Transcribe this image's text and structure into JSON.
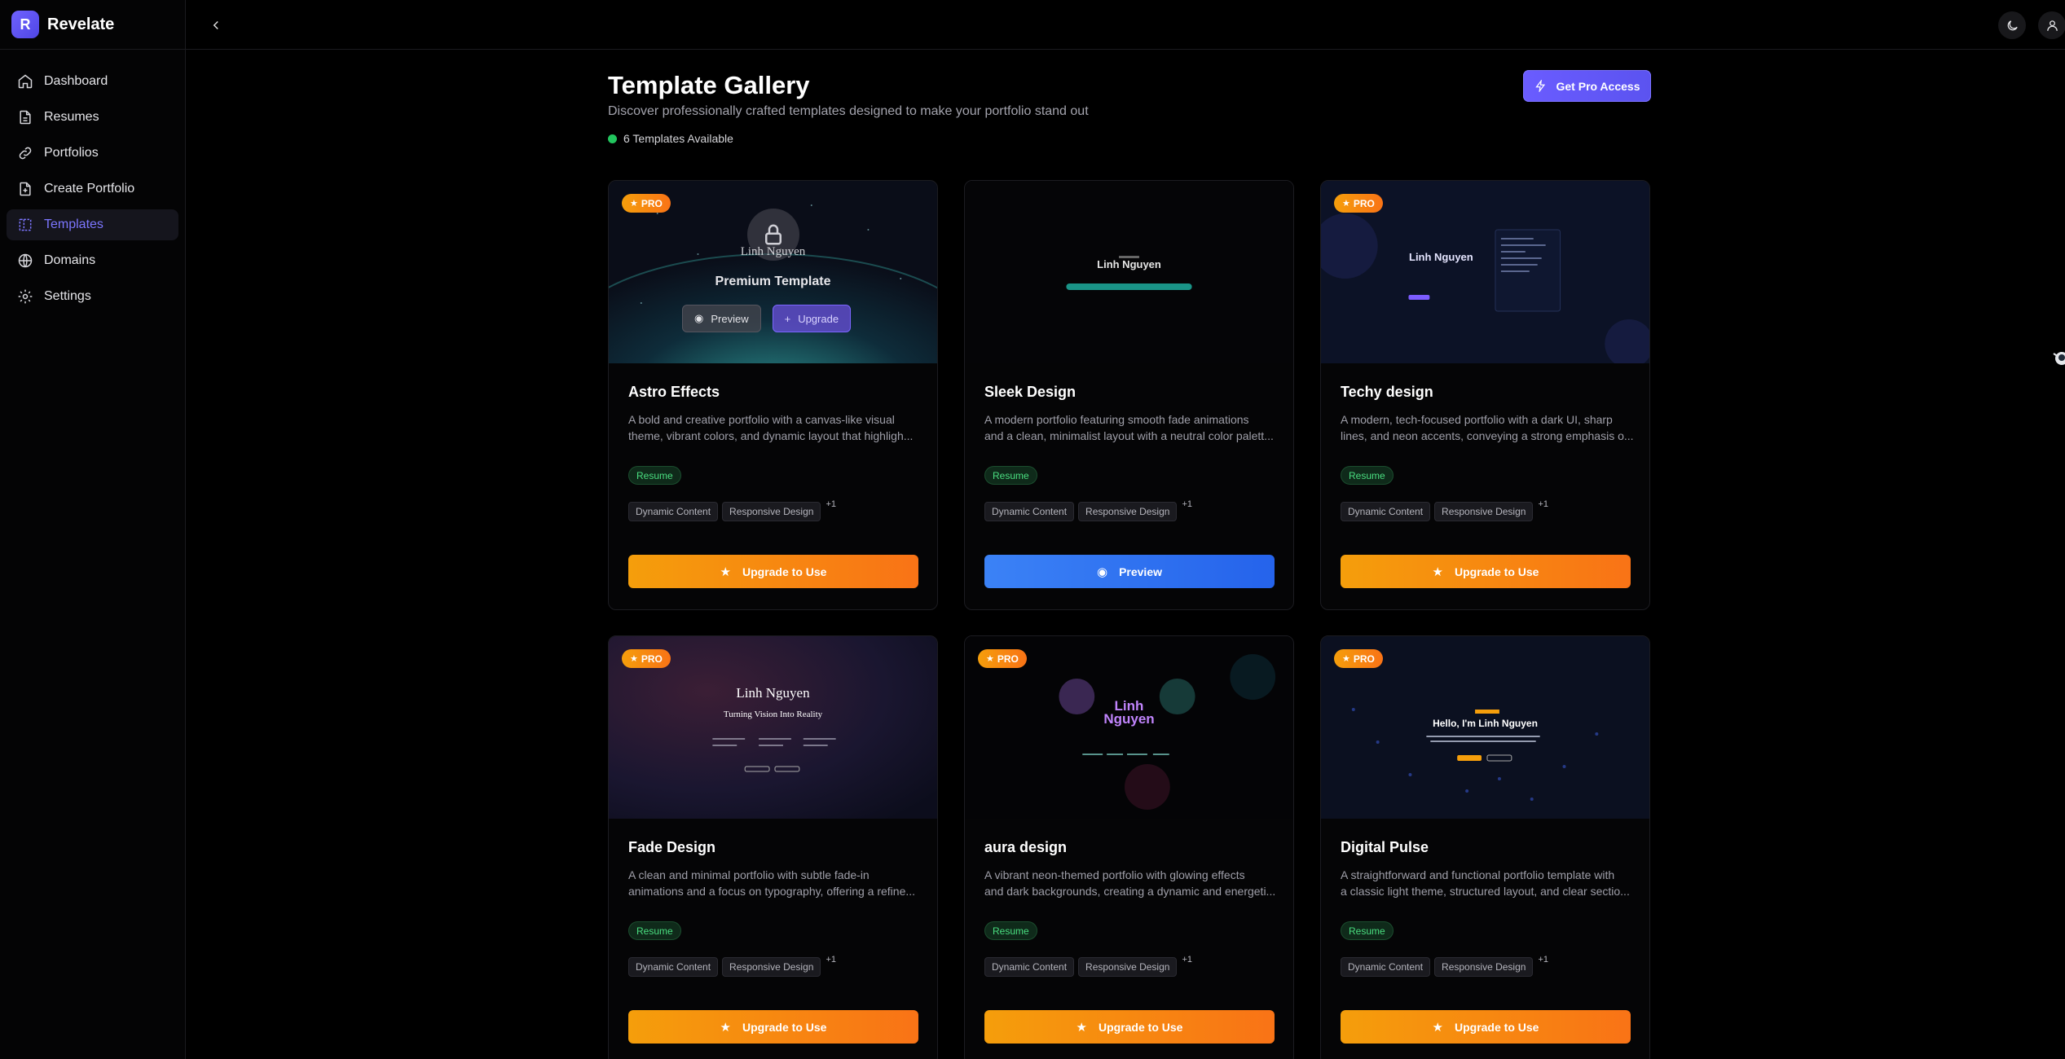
{
  "app": {
    "name": "Revelate",
    "logo_letter": "R"
  },
  "sidebar": {
    "items": [
      {
        "label": "Dashboard",
        "icon": "home-icon"
      },
      {
        "label": "Resumes",
        "icon": "file-text-icon"
      },
      {
        "label": "Portfolios",
        "icon": "link-icon"
      },
      {
        "label": "Create Portfolio",
        "icon": "file-plus-icon"
      },
      {
        "label": "Templates",
        "icon": "layout-dashed-icon",
        "active": true
      },
      {
        "label": "Domains",
        "icon": "globe-icon"
      },
      {
        "label": "Settings",
        "icon": "gear-icon"
      }
    ]
  },
  "header": {
    "title": "Template Gallery",
    "subtitle": "Discover professionally crafted templates designed to make your portfolio stand out",
    "count": "6 Templates Available",
    "pro_button": "Get Pro Access"
  },
  "cards": [
    {
      "title": "Astro Effects",
      "pro": true,
      "desc": [
        "A bold and creative portfolio with a canvas-like visual",
        "theme, vibrant colors, and dynamic layout that highligh..."
      ],
      "resume_tag": "Resume",
      "tags": [
        "Dynamic Content",
        "Responsive Design"
      ],
      "more": "+1",
      "cta": "Upgrade to Use",
      "overlay": {
        "title": "Premium Template",
        "preview": "Preview",
        "upgrade": "Upgrade"
      },
      "thumb_text": "Linh Nguyen"
    },
    {
      "title": "Sleek Design",
      "pro": false,
      "desc": [
        "A modern portfolio featuring smooth fade animations",
        "and a clean, minimalist layout with a neutral color palett..."
      ],
      "resume_tag": "Resume",
      "tags": [
        "Dynamic Content",
        "Responsive Design"
      ],
      "more": "+1",
      "cta": "Preview",
      "thumb_text": "Linh Nguyen"
    },
    {
      "title": "Techy design",
      "pro": true,
      "desc": [
        "A modern, tech-focused portfolio with a dark UI, sharp",
        "lines, and neon accents, conveying a strong emphasis o..."
      ],
      "resume_tag": "Resume",
      "tags": [
        "Dynamic Content",
        "Responsive Design"
      ],
      "more": "+1",
      "cta": "Upgrade to Use",
      "thumb_text": "Linh Nguyen"
    },
    {
      "title": "Fade Design",
      "pro": true,
      "desc": [
        "A clean and minimal portfolio with subtle fade-in",
        "animations and a focus on typography, offering a refine..."
      ],
      "resume_tag": "Resume",
      "tags": [
        "Dynamic Content",
        "Responsive Design"
      ],
      "more": "+1",
      "cta": "Upgrade to Use",
      "thumb_text": "Linh Nguyen",
      "thumb_sub": "Turning Vision Into Reality"
    },
    {
      "title": "aura design",
      "pro": true,
      "desc": [
        "A vibrant neon-themed portfolio with glowing effects",
        "and dark backgrounds, creating a dynamic and energeti..."
      ],
      "resume_tag": "Resume",
      "tags": [
        "Dynamic Content",
        "Responsive Design"
      ],
      "more": "+1",
      "cta": "Upgrade to Use",
      "thumb_text": "Linh Nguyen"
    },
    {
      "title": "Digital Pulse",
      "pro": true,
      "desc": [
        "A straightforward and functional portfolio template with",
        "a classic light theme, structured layout, and clear sectio..."
      ],
      "resume_tag": "Resume",
      "tags": [
        "Dynamic Content",
        "Responsive Design"
      ],
      "more": "+1",
      "cta": "Upgrade to Use",
      "thumb_text": "Hello, I'm Linh Nguyen"
    }
  ],
  "badges": {
    "pro": "PRO"
  },
  "colors": {
    "accent": "#6a5cff",
    "pro": "#f59e0b",
    "preview": "#3b82f6",
    "resume": "#4ade80"
  }
}
